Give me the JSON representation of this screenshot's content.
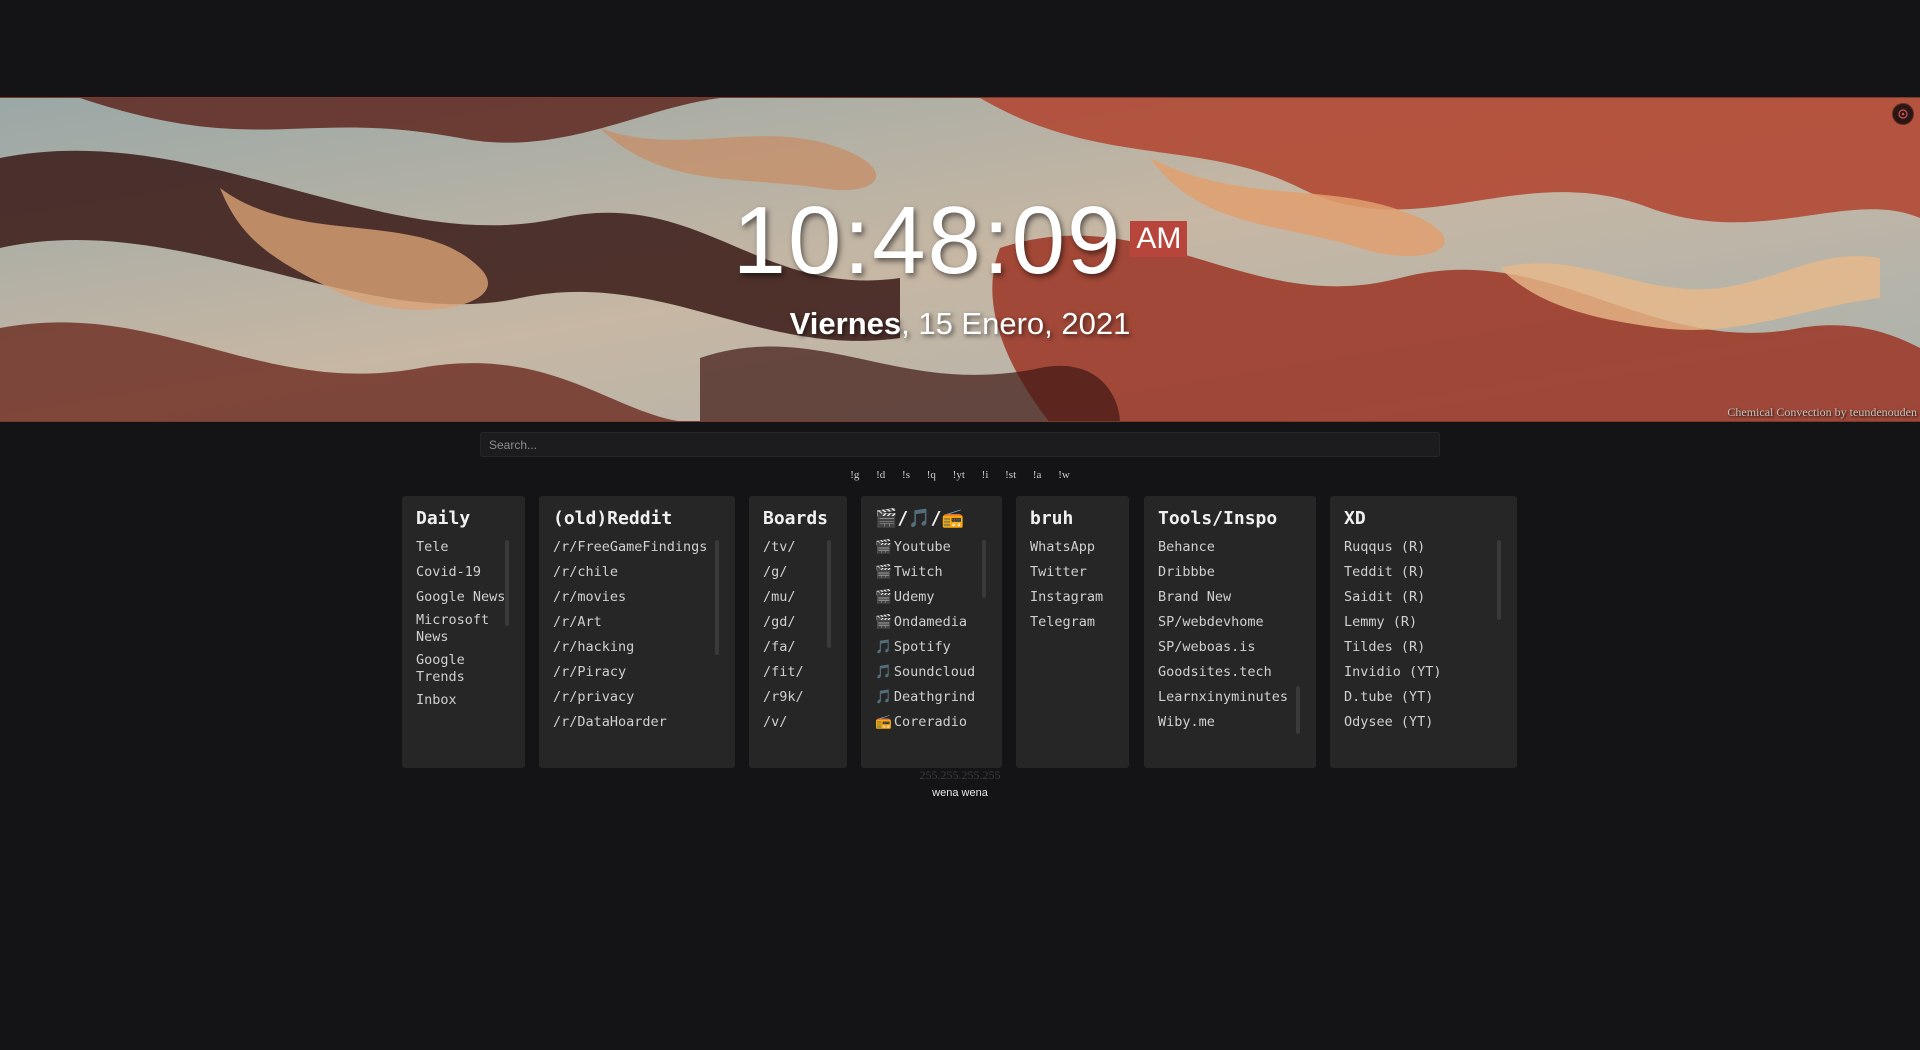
{
  "clock": {
    "time": "10:48:09",
    "ampm": "AM"
  },
  "date": {
    "weekday": "Viernes",
    "rest": ", 15 Enero, 2021"
  },
  "banner": {
    "credit": "Chemical Convection by teundenouden"
  },
  "search": {
    "placeholder": "Search..."
  },
  "bangs": [
    "!g",
    "!d",
    "!s",
    "!q",
    "!yt",
    "!i",
    "!st",
    "!a",
    "!w"
  ],
  "cards": {
    "daily": {
      "title": "Daily",
      "items": [
        "Tele",
        "Covid-19",
        "Google News",
        "Microsoft News",
        "Google Trends",
        "Inbox"
      ]
    },
    "reddit": {
      "title": "(old)Reddit",
      "items": [
        "/r/FreeGameFindings",
        "/r/chile",
        "/r/movies",
        "/r/Art",
        "/r/hacking",
        "/r/Piracy",
        "/r/privacy",
        "/r/DataHoarder"
      ]
    },
    "boards": {
      "title": "Boards",
      "items": [
        "/tv/",
        "/g/",
        "/mu/",
        "/gd/",
        "/fa/",
        "/fit/",
        "/r9k/",
        "/v/"
      ]
    },
    "media": {
      "title": "🎬/🎵/📻",
      "items": [
        {
          "icon": "🎬",
          "label": "Youtube"
        },
        {
          "icon": "🎬",
          "label": "Twitch"
        },
        {
          "icon": "🎬",
          "label": "Udemy"
        },
        {
          "icon": "🎬",
          "label": "Ondamedia"
        },
        {
          "icon": "🎵",
          "label": "Spotify"
        },
        {
          "icon": "🎵",
          "label": "Soundcloud"
        },
        {
          "icon": "🎵",
          "label": "Deathgrind"
        },
        {
          "icon": "📻",
          "label": "Coreradio"
        }
      ]
    },
    "bruh": {
      "title": "bruh",
      "items": [
        "WhatsApp",
        "Twitter",
        "Instagram",
        "Telegram"
      ]
    },
    "tools": {
      "title": "Tools/Inspo",
      "items": [
        "Behance",
        "Dribbbe",
        "Brand New",
        "SP/webdevhome",
        "SP/weboas.is",
        "Goodsites.tech",
        "Learnxinyminutes",
        "Wiby.me"
      ]
    },
    "xd": {
      "title": "XD",
      "items": [
        "Ruqqus (R)",
        "Teddit (R)",
        "Saidit (R)",
        "Lemmy (R)",
        "Tildes (R)",
        "Invidio (YT)",
        "D.tube (YT)",
        "Odysee (YT)"
      ]
    }
  },
  "ip": "255.255.255.255",
  "footer": "wena wena"
}
